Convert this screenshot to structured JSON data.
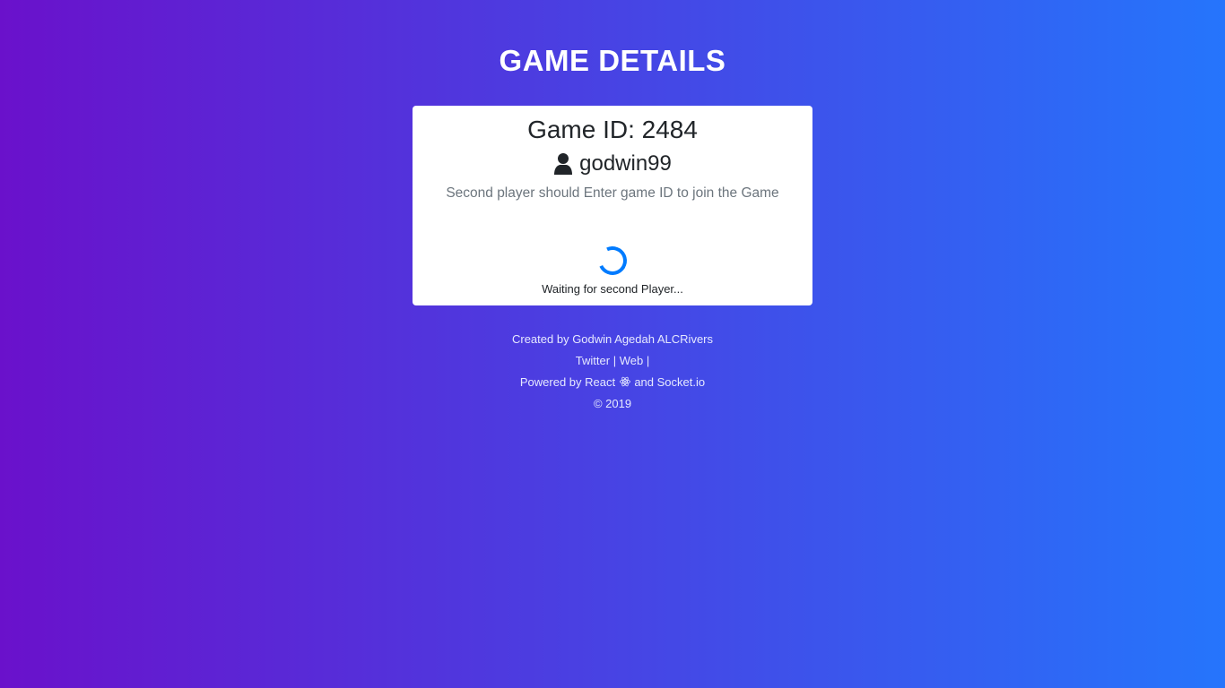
{
  "page": {
    "title": "GAME DETAILS"
  },
  "card": {
    "game_id_label": "Game ID: 2484",
    "player": {
      "icon": "user-icon",
      "username": "godwin99"
    },
    "instructions": "Second player should Enter game ID to join the Game",
    "spinner_color": "#007bff",
    "waiting_text": "Waiting for second Player..."
  },
  "footer": {
    "credit_prefix": "Created by ",
    "author": "Godwin Agedah",
    "credit_suffix": " ALCRivers",
    "twitter_label": "Twitter",
    "separator1": " | ",
    "web_label": "Web",
    "separator2": " |",
    "powered_prefix": "Powered by React ",
    "powered_icon": "react-icon",
    "powered_suffix": " and Socket.io",
    "copyright": "© 2019"
  },
  "colors": {
    "gradient_start": "#6a11cb",
    "gradient_end": "#2575fc",
    "card_bg": "#ffffff",
    "muted_text": "#6c757d"
  }
}
